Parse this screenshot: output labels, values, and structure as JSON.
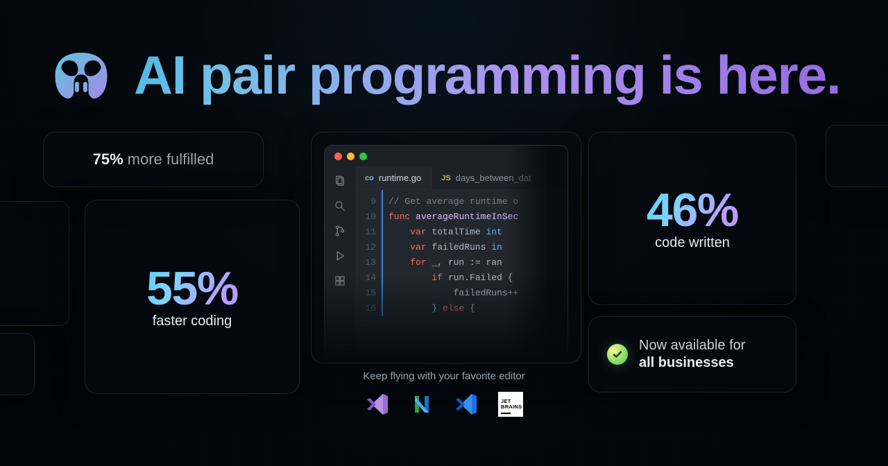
{
  "hero": {
    "title": "AI pair programming is here."
  },
  "stats": {
    "fulfilled": {
      "value": "75%",
      "label": "more fulfilled"
    },
    "faster": {
      "value": "55%",
      "label": "faster coding"
    },
    "written": {
      "value": "46%",
      "label": "code written"
    }
  },
  "availability": {
    "prefix": "Now available for",
    "emphasis": "all businesses"
  },
  "editor": {
    "active_tab_icon": "co",
    "active_tab": "runtime.go",
    "inactive_tab_icon": "JS",
    "inactive_tab": "days_between_dat",
    "gutter": " 9\n10\n11\n12\n13\n14\n15\n16",
    "code_lines": [
      {
        "kind": "comment",
        "text": "// Get average runtime o"
      },
      {
        "kind": "func",
        "kw": "func",
        "name": "averageRuntimeInSec"
      },
      {
        "kind": "var",
        "kw": "var",
        "name": "totalTime",
        "type": "int"
      },
      {
        "kind": "var",
        "kw": "var",
        "name": "failedRuns",
        "type": "in"
      },
      {
        "kind": "for",
        "text": "for _, run := ran"
      },
      {
        "kind": "if",
        "text": "if run.Failed {"
      },
      {
        "kind": "stmt",
        "text": "failedRuns++"
      },
      {
        "kind": "else",
        "text": "} else {"
      }
    ]
  },
  "editors_strip": {
    "caption": "Keep flying with your favorite editor",
    "jetbrains_line1": "JET",
    "jetbrains_line2": "BRAINS"
  }
}
